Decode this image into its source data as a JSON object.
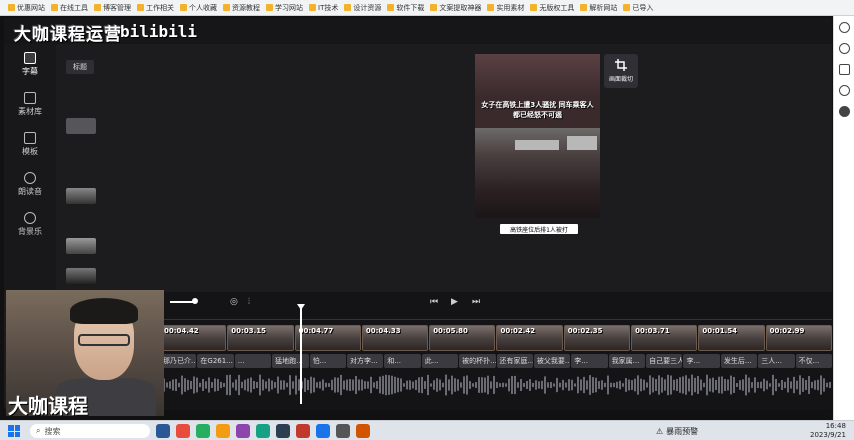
{
  "bookmarks": [
    "优惠网站",
    "在线工具",
    "博客管理",
    "工作相关",
    "个人收藏",
    "资源教程",
    "学习网站",
    "IT技术",
    "设计资源",
    "软件下载",
    "文案提取神器",
    "实用素材",
    "无版权工具",
    "解析网站",
    "已导入"
  ],
  "browser_strip": [
    "refresh-icon",
    "search-icon",
    "bookmark-icon",
    "settings-icon",
    "user-icon"
  ],
  "brand": {
    "channel": "大咖课程运营",
    "logo": "bilibili"
  },
  "nav": [
    {
      "label": "字幕",
      "icon": "subtitle-icon",
      "active": true
    },
    {
      "label": "素材库",
      "icon": "cube-icon",
      "active": false
    },
    {
      "label": "模板",
      "icon": "template-icon",
      "active": false
    },
    {
      "label": "朗读音",
      "icon": "voice-icon",
      "active": false
    },
    {
      "label": "背景乐",
      "icon": "music-icon",
      "active": false
    }
  ],
  "asset_panel": {
    "tab": "标题"
  },
  "preview": {
    "caption": "女子在高铁上遭3人骚扰 同车乘客人都已经怒不可遏",
    "subtitle": "高铁座位后排1人被打",
    "crop_label": "画面裁切"
  },
  "timeline": {
    "clips": [
      "00:04.42",
      "00:03.15",
      "00:04.77",
      "00:04.33",
      "00:05.80",
      "00:02.42",
      "00:02.35",
      "00:03.71",
      "00:01.54",
      "00:02.99"
    ],
    "subtitles": [
      "那乃已介...",
      "在G261...",
      "...",
      "猛地跑...",
      "怕...",
      "对方李...",
      "和...",
      "此...",
      "被的杯扑...",
      "还有家庭...",
      "被父我要...",
      "李...",
      "我家属...",
      "自己要三人...",
      "李...",
      "发生后...",
      "三人...",
      "不仅..."
    ]
  },
  "webcam": {
    "watermark": "大咖课程"
  },
  "taskbar": {
    "search_placeholder": "搜索",
    "weather": "暴雨预警",
    "time": "16:48",
    "date": "2023/9/21"
  }
}
